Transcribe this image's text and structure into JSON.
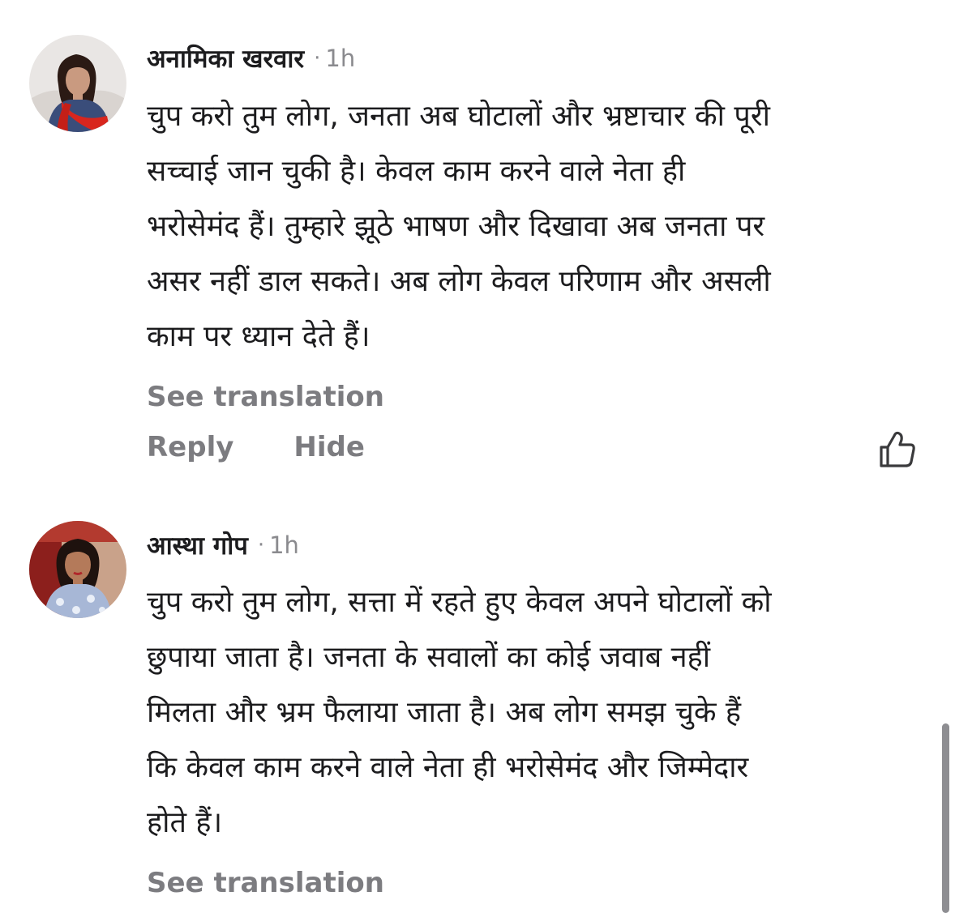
{
  "comments": [
    {
      "author": "अनामिका खरवार",
      "separator": "·",
      "time": "1h",
      "text_lines": [
        "चुप करो तुम लोग, जनता अब घोटालों और भ्रष्टाचार की पूरी",
        "सच्चाई जान चुकी है। केवल काम करने वाले नेता ही",
        "भरोसेमंद हैं। तुम्हारे झूठे भाषण और दिखावा अब जनता पर",
        "असर नहीं डाल सकते। अब लोग केवल परिणाम और असली",
        "काम पर ध्यान देते हैं।"
      ],
      "see_translation": "See translation",
      "reply_label": "Reply",
      "hide_label": "Hide",
      "avatar_icon": "avatar-photo-woman-red-dupatta",
      "like_icon": "thumbs-up-outline-icon"
    },
    {
      "author": "आस्था गोप",
      "separator": "·",
      "time": "1h",
      "text_lines": [
        "चुप करो तुम लोग, सत्ता में रहते हुए केवल अपने घोटालों को",
        "छुपाया जाता है। जनता के सवालों का कोई जवाब नहीं",
        "मिलता और भ्रम फैलाया जाता है। अब लोग समझ चुके हैं",
        "कि केवल काम करने वाले नेता ही भरोसेमंद और जिम्मेदार",
        "होते हैं।"
      ],
      "see_translation": "See translation",
      "avatar_icon": "avatar-photo-woman-blue-floral"
    }
  ],
  "colors": {
    "text": "#1c1c1e",
    "secondary": "#7c7c80",
    "scrollbar": "#8e8e92"
  }
}
